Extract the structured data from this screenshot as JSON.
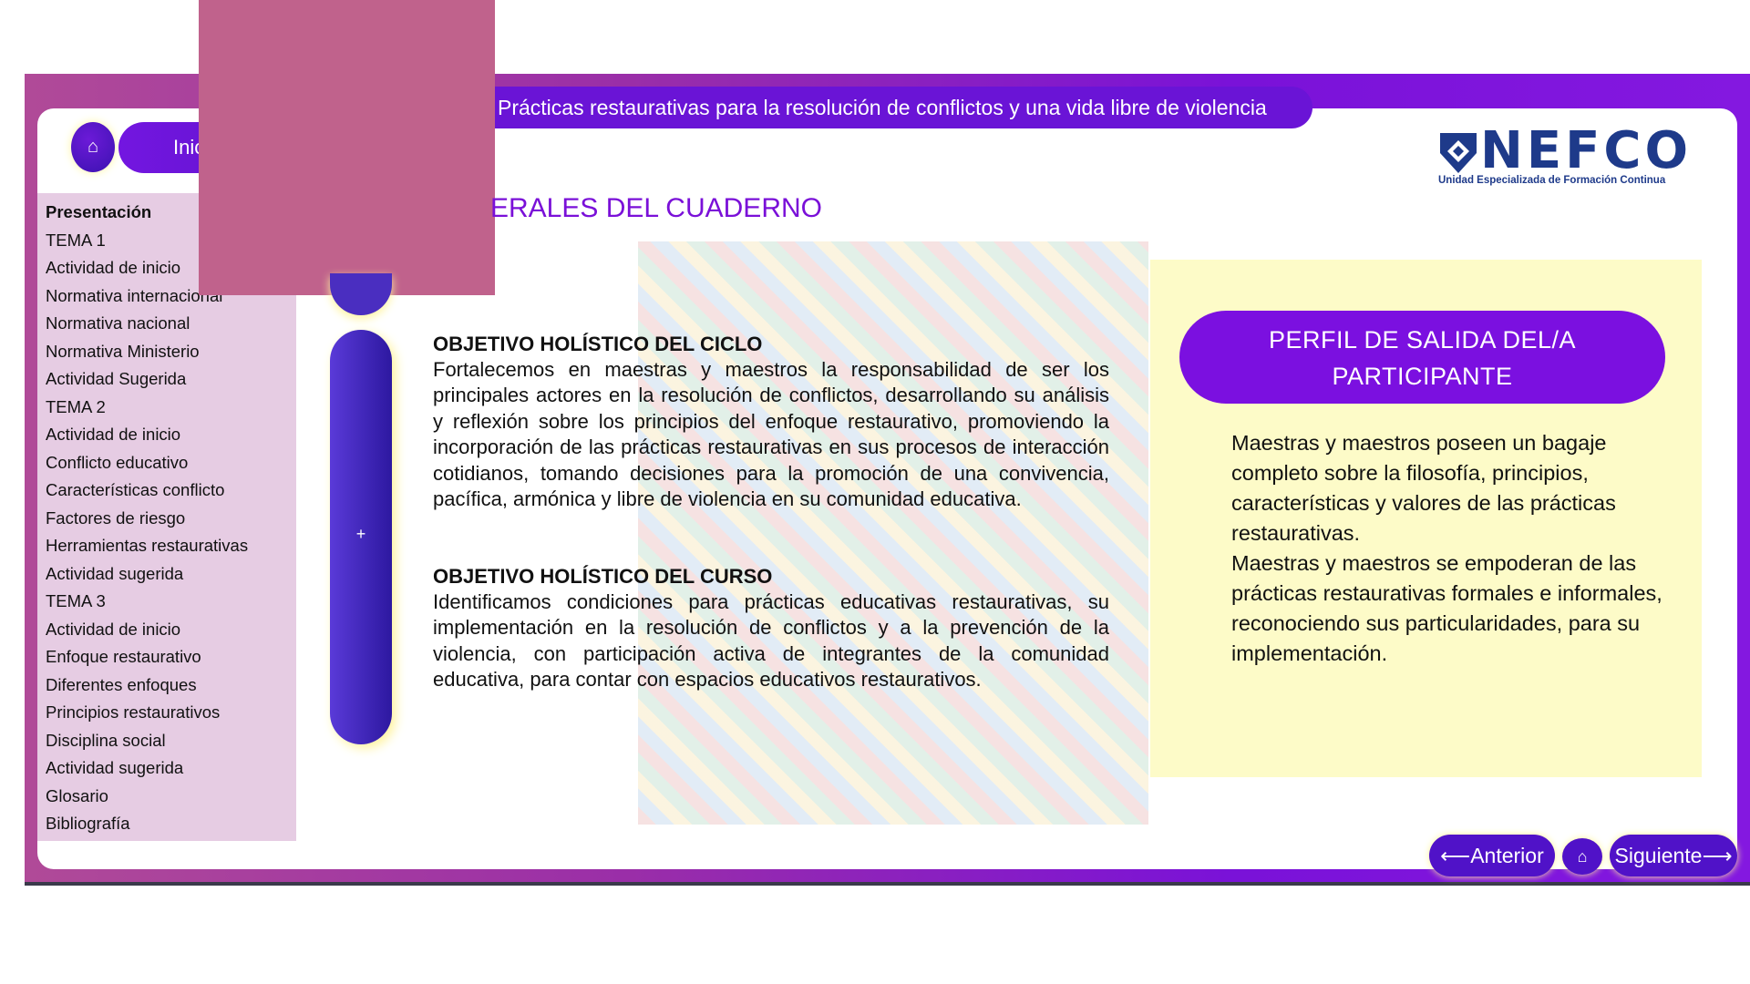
{
  "header": {
    "course_title": "Prácticas restaurativas para la resolución de conflictos y una vida libre de violencia",
    "home_icon": "⌂",
    "inicio_label": "Inic"
  },
  "logo": {
    "name": "NEFCO",
    "subtitle": "Unidad Especializada de Formación Continua"
  },
  "sidebar": {
    "items": [
      "Presentación",
      "TEMA 1",
      "Actividad de inicio",
      "Normativa internacional",
      "Normativa nacional",
      "Normativa Ministerio",
      "Actividad Sugerida",
      "TEMA 2",
      "Actividad de inicio",
      "Conflicto educativo",
      "Características conflicto",
      "Factores de riesgo",
      "Herramientas restaurativas",
      "Actividad sugerida",
      "TEMA 3",
      "Actividad de inicio",
      "Enfoque restaurativo",
      "Diferentes enfoques",
      "Principios restaurativos",
      "Disciplina social",
      "Actividad sugerida",
      "Glosario",
      "Bibliografía"
    ]
  },
  "main": {
    "section_title": "ERALES DEL CUADERNO",
    "expand_label": "+",
    "objetivo_ciclo": {
      "heading": "OBJETIVO HOLÍSTICO DEL CICLO",
      "text": "Fortalecemos en maestras y maestros la responsabilidad de ser los principales actores en la resolución de conflictos, desarrollando su análisis y reflexión sobre los principios del enfoque restaurativo, promoviendo la incorporación de las prácticas restaurativas en sus procesos de interacción cotidianos, tomando decisiones para la promoción de una convivencia, pacífica, armónica y libre de violencia en su comunidad educativa."
    },
    "objetivo_curso": {
      "heading": "OBJETIVO HOLÍSTICO DEL CURSO",
      "text": "Identificamos condiciones para prácticas educativas restaurativas, su implementación en la resolución de conflictos y a la prevención de la violencia, con participación activa de integrantes de la comunidad educativa, para contar con espacios educativos restaurativos."
    },
    "perfil": {
      "title_line1": "PERFIL DE SALIDA DEL/A",
      "title_line2": "PARTICIPANTE",
      "paragraph1": "Maestras y maestros poseen un bagaje completo sobre la filosofía, principios, características y valores de las prácticas restaurativas.",
      "paragraph2": "Maestras y maestros se empoderan de las prácticas restaurativas formales e informales, reconociendo sus particularidades, para su implementación."
    }
  },
  "footer": {
    "prev_label": "⟵Anterior",
    "home_icon": "⌂",
    "next_label": "Siguiente⟶"
  },
  "colors": {
    "accent": "#7a10d8",
    "frame": "#9a2ea8",
    "sidebar_bg": "#e6cce3",
    "yellow_box": "#fdfbc8",
    "overlay": "#c0628c"
  }
}
